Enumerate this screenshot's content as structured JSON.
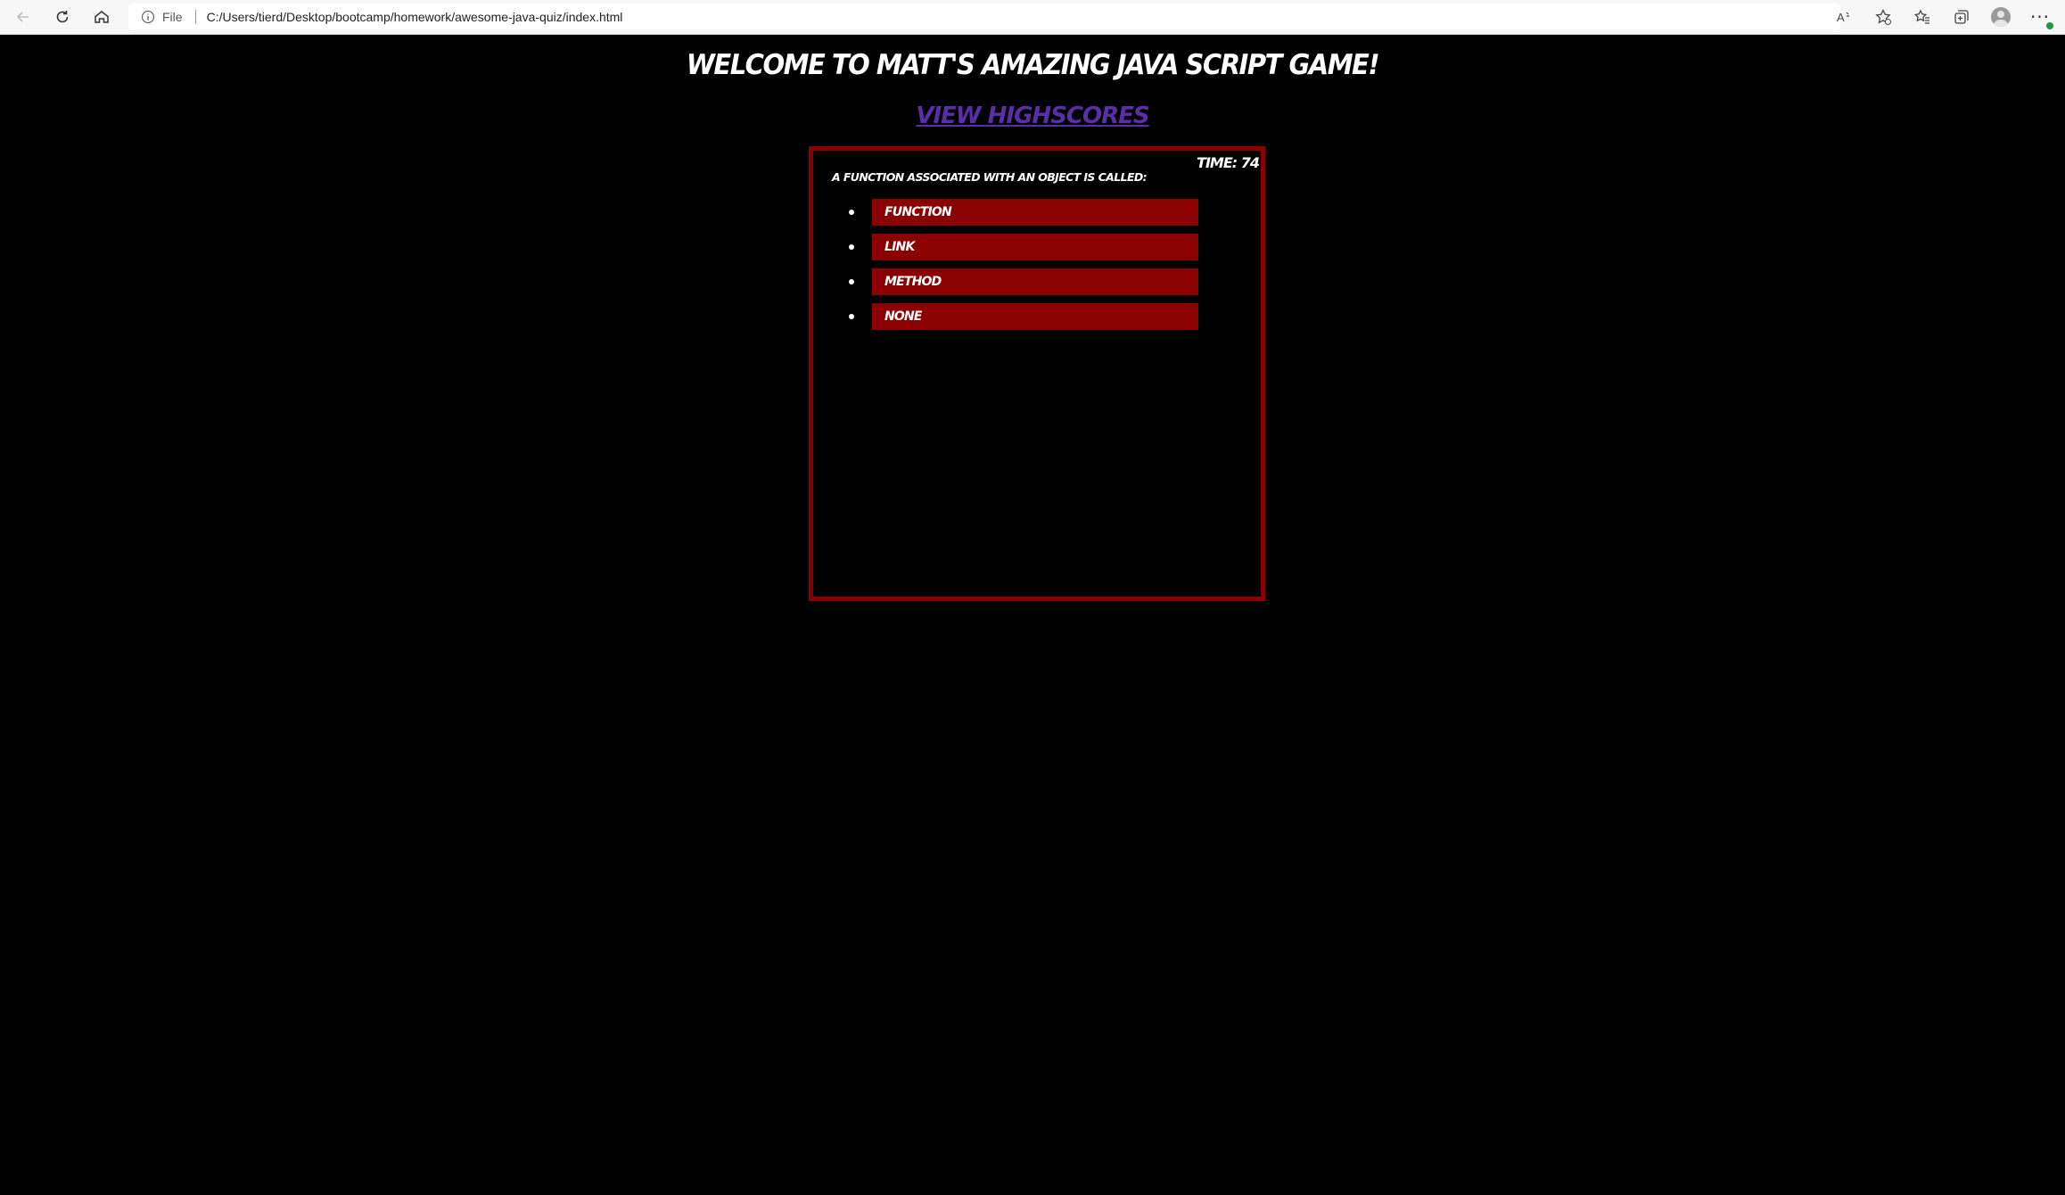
{
  "browser": {
    "file_label": "File",
    "url": "C:/Users/tierd/Desktop/bootcamp/homework/awesome-java-quiz/index.html",
    "icons": [
      "back-arrow-icon",
      "refresh-icon",
      "home-icon",
      "info-icon",
      "read-aloud-icon",
      "add-favorite-icon",
      "favorites-icon",
      "collections-icon",
      "profile-icon",
      "more-icon"
    ]
  },
  "page": {
    "title": "Welcome to Matt's amazing Java Script Game!",
    "highscores_link": "View Highscores",
    "timer_label": "Time: 74",
    "question": "A function associated with an object is called:",
    "answers": [
      "Function",
      "Link",
      "Method",
      "None"
    ]
  },
  "colors": {
    "background": "#000000",
    "accent_red": "#8b0000",
    "link_purple": "#5a2ea6",
    "text": "#ffffff"
  }
}
